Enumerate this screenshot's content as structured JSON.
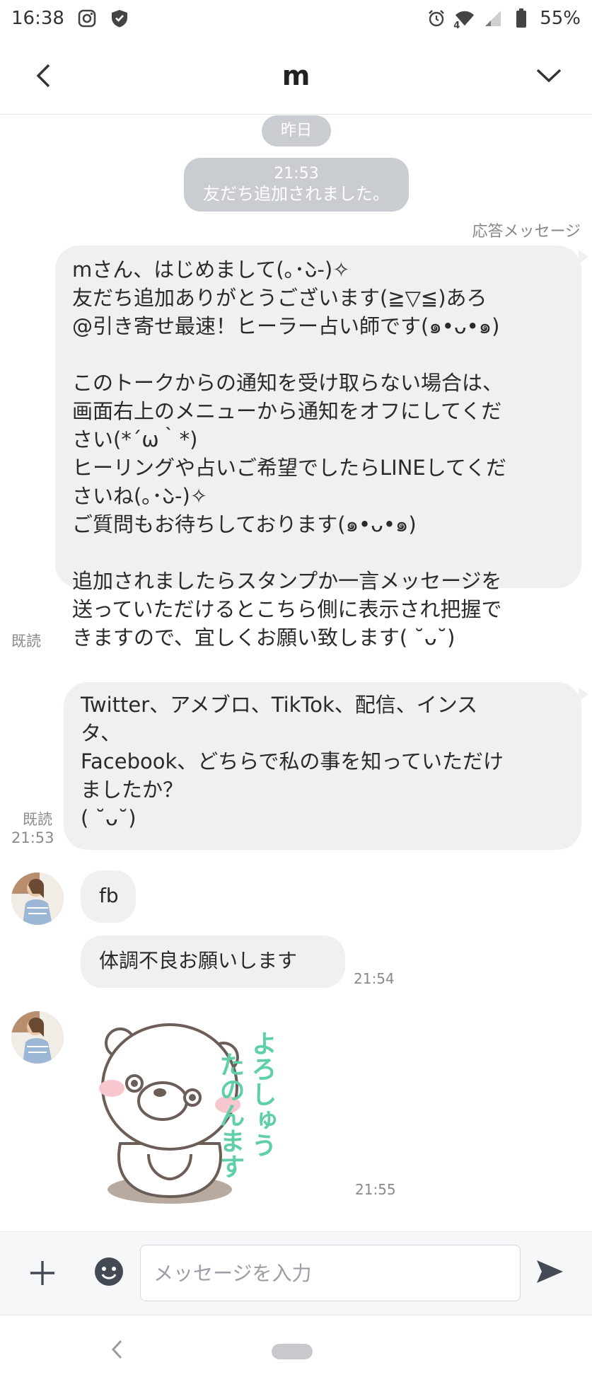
{
  "status_bar": {
    "time": "16:38",
    "battery": "55%",
    "network_badge": "4",
    "icons": [
      "instagram-icon",
      "shield-icon",
      "alarm-icon",
      "wifi-icon",
      "signal-icon",
      "battery-icon"
    ]
  },
  "header": {
    "title": "m",
    "back_icon": "chevron-left-icon",
    "menu_icon": "chevron-down-icon"
  },
  "chat": {
    "date_separator": "昨日",
    "system_message": {
      "time": "21:53",
      "text": "友だち追加されました。"
    },
    "auto_reply_label": "応答メッセージ",
    "messages": [
      {
        "text": "mさん、はじめまして(｡･̀ᴗ-)✧\n友だち追加ありがとうございます(≧▽≦)あろ\n@引き寄せ最速！ヒーラー占い師です(๑•ᴗ•๑)\n\nこのトークからの通知を受け取らない場合は、\n画面右上のメニューから通知をオフにしてくだ\nさい(*´ω｀*)\nヒーリングや占いご希望でしたらLINEしてくだ\nさいね(｡･̀ᴗ-)✧\nご質問もお待ちしております(๑•ᴗ•๑)\n\n追加されましたらスタンプか一言メッセージを\n送っていただけるとこちら側に表示され把握で\nきますので、宜しくお願い致します( ˘ᴗ˘)",
        "read": "既読"
      },
      {
        "text": "Twitter、アメブロ、TikTok、配信、インス\nタ、\nFacebook、どちらで私の事を知っていただけ\nましたか？\n( ˘ᴗ˘)",
        "read": "既読",
        "time": "21:53"
      },
      {
        "text": "fb"
      },
      {
        "text": "体調不良お願いします",
        "time": "21:54"
      },
      {
        "sticker_text": "よろしゅう たのんます",
        "time": "21:55"
      }
    ]
  },
  "input_bar": {
    "placeholder": "メッセージを入力",
    "plus_icon": "plus-icon",
    "emoji_icon": "emoji-icon",
    "send_icon": "send-icon"
  },
  "nav_bar": {
    "back_icon": "nav-back-icon",
    "home_icon": "home-pill-icon"
  },
  "colors": {
    "bubble": "#eff0f2",
    "pill": "#c9ccd1",
    "sticker_text": "#5fd0a6"
  }
}
